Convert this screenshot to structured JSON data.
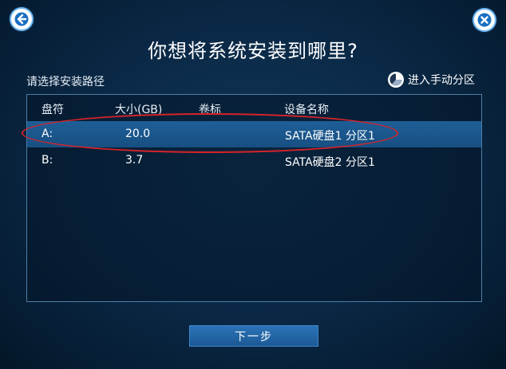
{
  "header": {
    "title": "你想将系统安装到哪里?",
    "back_icon": "back-arrow-icon",
    "close_icon": "close-icon"
  },
  "subtitle": "请选择安装路径",
  "manual_partition": {
    "label": "进入手动分区",
    "icon": "pie-chart-icon"
  },
  "table": {
    "columns": [
      "盘符",
      "大小(GB)",
      "卷标",
      "设备名称"
    ],
    "rows": [
      {
        "drive": "A:",
        "size": "20.0",
        "label": "",
        "device": "SATA硬盘1 分区1",
        "selected": true
      },
      {
        "drive": "B:",
        "size": "3.7",
        "label": "",
        "device": "SATA硬盘2 分区1",
        "selected": false
      }
    ]
  },
  "next_button": "下一步",
  "colors": {
    "background": "#0b2a48",
    "selected_row": "#1b5a8f",
    "button": "#2467a7",
    "highlight": "#d8232a"
  }
}
